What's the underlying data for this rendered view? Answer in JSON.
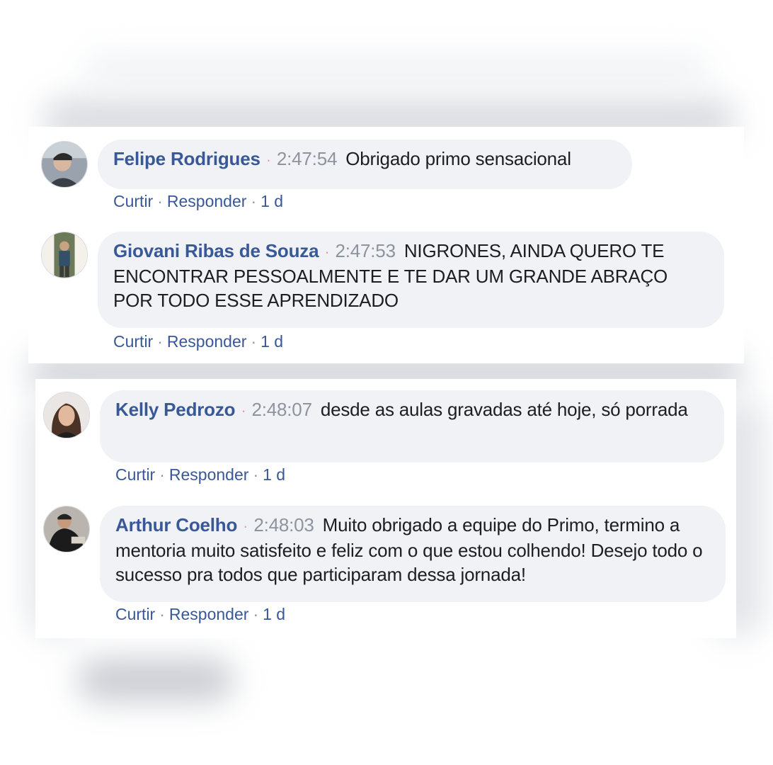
{
  "comments": [
    {
      "author": "Felipe Rodrigues",
      "time": "2:47:54",
      "text": "Obrigado primo sensacional",
      "like": "Curtir",
      "reply": "Responder",
      "age": "1 d"
    },
    {
      "author": "Giovani Ribas de Souza",
      "time": "2:47:53",
      "text": "NIGRONES, AINDA QUERO TE ENCONTRAR PESSOALMENTE E TE DAR UM GRANDE ABRAÇO POR TODO ESSE APRENDIZADO",
      "like": "Curtir",
      "reply": "Responder",
      "age": "1 d"
    },
    {
      "author": "Kelly Pedrozo",
      "time": "2:48:07",
      "text": "desde as aulas gravadas até hoje, só porrada",
      "like": "Curtir",
      "reply": "Responder",
      "age": "1 d"
    },
    {
      "author": "Arthur Coelho",
      "time": "2:48:03",
      "text": "Muito obrigado a equipe do Primo, termino a mentoria muito satisfeito e feliz com o que estou colhendo! Desejo todo o sucesso pra todos que participaram dessa jornada!",
      "like": "Curtir",
      "reply": "Responder",
      "age": "1 d"
    }
  ],
  "colors": {
    "author": "#385898",
    "bubble": "#f0f2f5",
    "timestamp": "#8d949e",
    "text": "#1c1e21"
  }
}
